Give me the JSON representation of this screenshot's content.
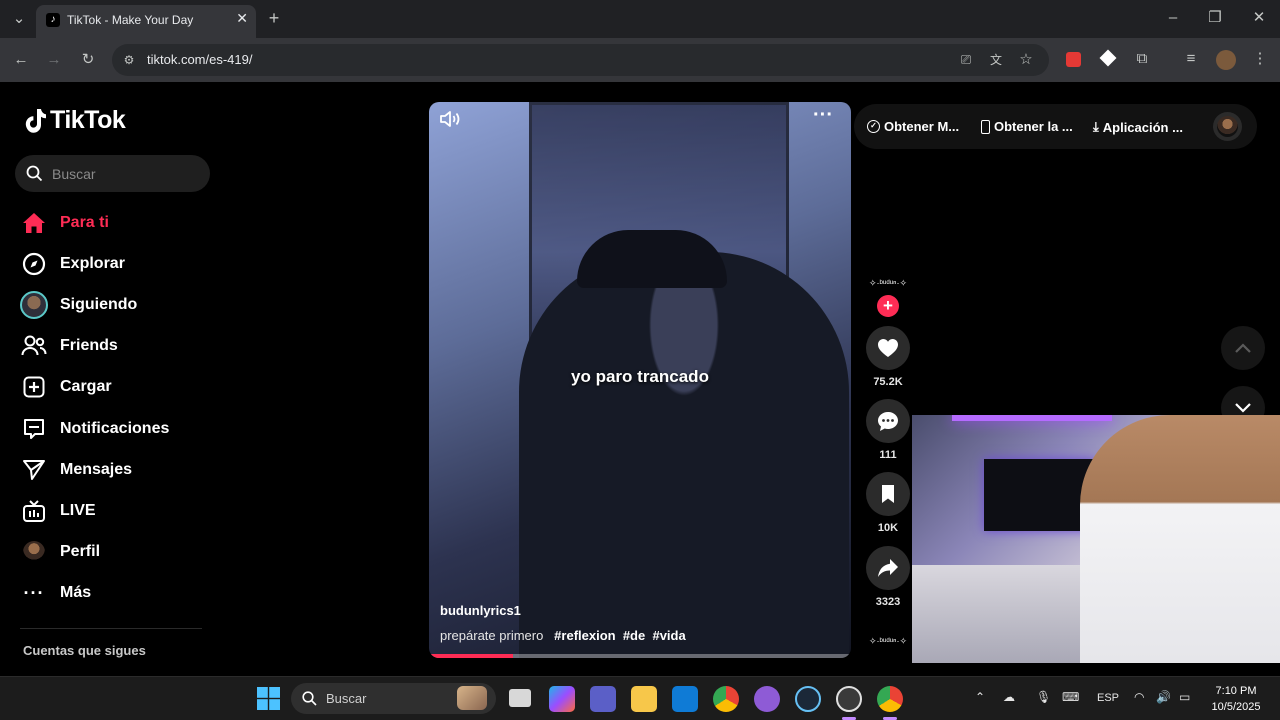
{
  "browser": {
    "tab_title": "TikTok - Make Your Day",
    "url": "tiktok.com/es-419/"
  },
  "sidebar": {
    "logo_text": "TikTok",
    "search_placeholder": "Buscar",
    "items": [
      {
        "label": "Para ti",
        "icon": "home-icon",
        "active": true
      },
      {
        "label": "Explorar",
        "icon": "compass-icon"
      },
      {
        "label": "Siguiendo",
        "icon": "avatar-icon"
      },
      {
        "label": "Friends",
        "icon": "friends-icon"
      },
      {
        "label": "Cargar",
        "icon": "upload-icon"
      },
      {
        "label": "Notificaciones",
        "icon": "inbox-icon"
      },
      {
        "label": "Mensajes",
        "icon": "send-icon"
      },
      {
        "label": "LIVE",
        "icon": "live-tv-icon"
      },
      {
        "label": "Perfil",
        "icon": "profile-icon"
      },
      {
        "label": "Más",
        "icon": "more-icon"
      }
    ],
    "following_title": "Cuentas que sigues"
  },
  "video": {
    "caption_overlay": "yo paro trancado",
    "author": "budunlyrics1",
    "description": "prepárate primero",
    "hashtags": [
      "#reflexion",
      "#de",
      "#vida"
    ],
    "progress": 0.2,
    "likes": "75.2K",
    "comments": "111",
    "saves": "10K",
    "shares": "3323"
  },
  "topbar": {
    "get_coins": "Obtener M...",
    "get_app": "Obtener la ...",
    "desktop_app": "Aplicación ..."
  },
  "taskbar": {
    "search_placeholder": "Buscar",
    "language": "ESP",
    "time": "7:10 PM",
    "date": "10/5/2025"
  },
  "colors": {
    "accent": "#fe2c55",
    "background": "#000000"
  }
}
